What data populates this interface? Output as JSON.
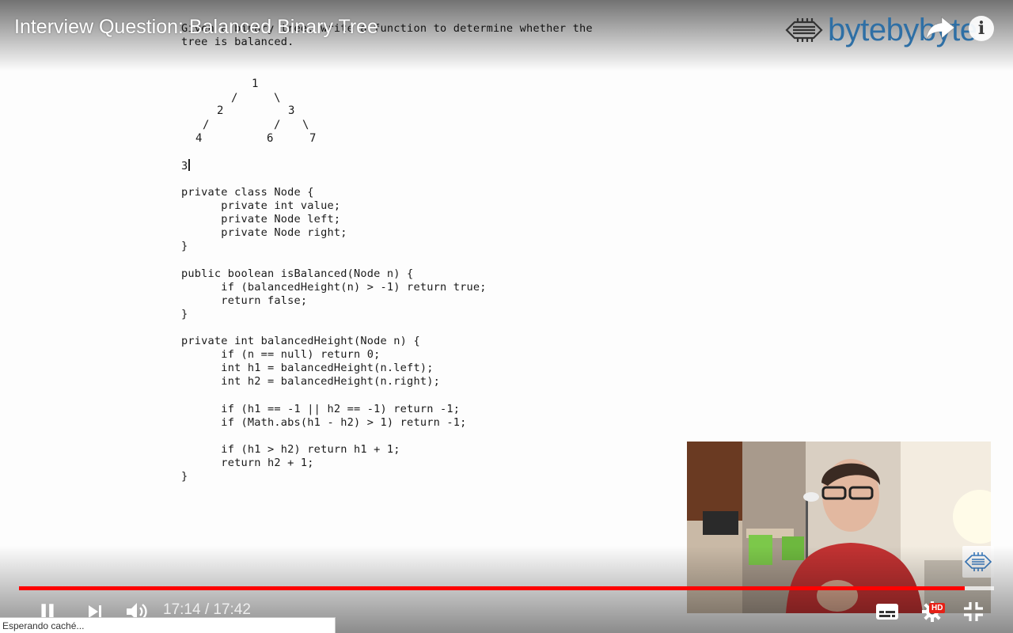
{
  "video": {
    "title": "Interview Question: Balanced Binary Tree",
    "brand": "bytebybyte",
    "progress_fraction": 0.97,
    "buffer_fraction": 1.0
  },
  "slide": {
    "intro_lines": [
      "Given a binary tree, write a function to determine whether the",
      "tree is balanced."
    ],
    "tree": {
      "root": "1",
      "left": "2",
      "right": "3",
      "left_left": "4",
      "right_left": "6",
      "right_right": "7"
    },
    "annotation": "3",
    "code_lines": [
      "private class Node {",
      "      private int value;",
      "      private Node left;",
      "      private Node right;",
      "}",
      "",
      "public boolean isBalanced(Node n) {",
      "      if (balancedHeight(n) > -1) return true;",
      "      return false;",
      "}",
      "",
      "private int balancedHeight(Node n) {",
      "      if (n == null) return 0;",
      "      int h1 = balancedHeight(n.left);",
      "      int h2 = balancedHeight(n.right);",
      "",
      "      if (h1 == -1 || h2 == -1) return -1;",
      "      if (Math.abs(h1 - h2) > 1) return -1;",
      "",
      "      if (h1 > h2) return h1 + 1;",
      "      return h2 + 1;",
      "}"
    ]
  },
  "controls": {
    "current_time": "17:14",
    "separator": " / ",
    "duration": "17:42",
    "hd_label": "HD",
    "info_label": "i",
    "colors": {
      "progress": "#ff0000",
      "hd_badge": "#e62117",
      "brand": "#2e6fa5"
    }
  },
  "status_bar": {
    "text": "Esperando caché..."
  },
  "icons": [
    "pause-icon",
    "next-icon",
    "volume-icon",
    "subtitles-icon",
    "settings-icon",
    "exit-fullscreen-icon",
    "share-icon",
    "info-icon",
    "chip-logo-icon"
  ]
}
